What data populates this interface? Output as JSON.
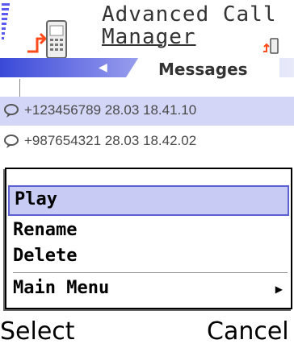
{
  "header": {
    "title_line1": "Advanced Call",
    "title_line2": "Manager",
    "tab_label": "Messages"
  },
  "list": {
    "items": [
      {
        "text": "+123456789 28.03 18.41.10",
        "selected": true
      },
      {
        "text": "+987654321 28.03 18.42.02",
        "selected": false
      }
    ]
  },
  "menu": {
    "items": [
      {
        "label": "Play"
      },
      {
        "label": "Rename"
      },
      {
        "label": "Delete"
      },
      {
        "label": "Main Menu"
      }
    ]
  },
  "softkeys": {
    "left": "Select",
    "right": "Cancel"
  },
  "colors": {
    "accent": "#5b5fd2",
    "highlight": "#c8cbf3",
    "selected_row": "#d4d6f7"
  }
}
